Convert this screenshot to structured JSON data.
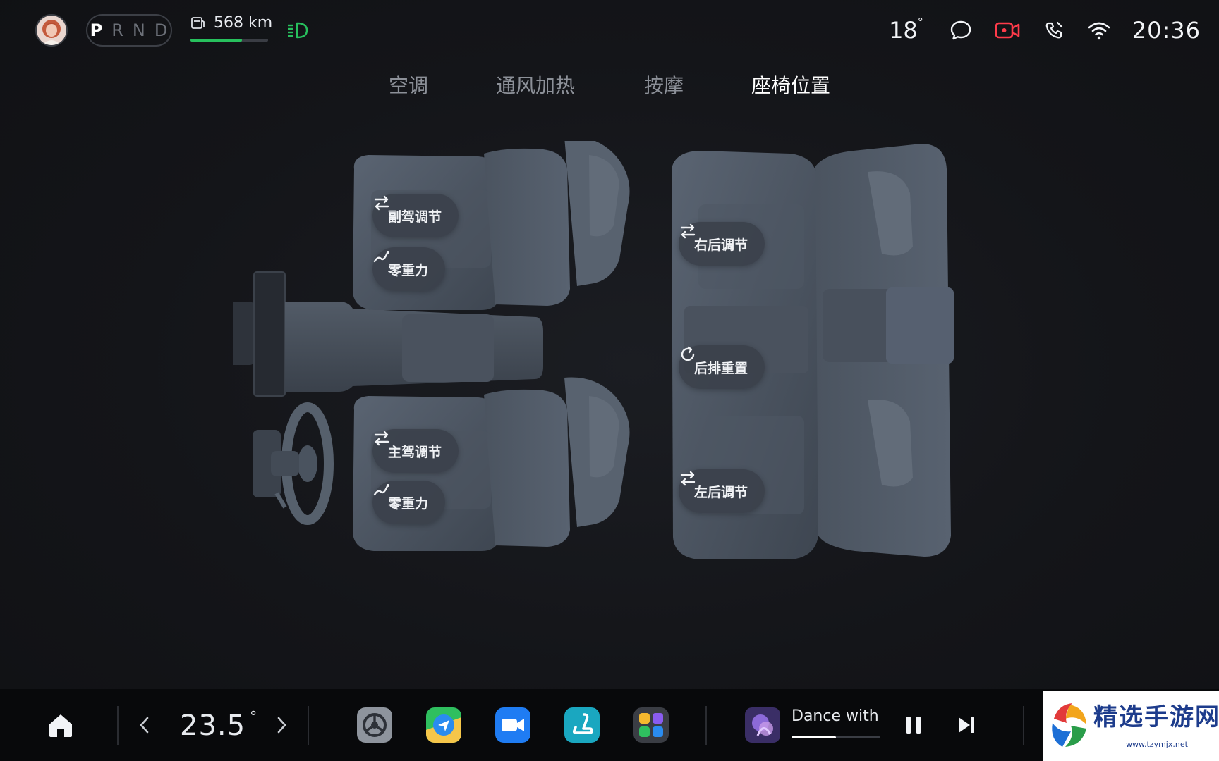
{
  "status": {
    "gears": [
      "P",
      "R",
      "N",
      "D"
    ],
    "active_gear": "P",
    "range": "568 km",
    "range_fraction": 0.66,
    "outside_temp": "18",
    "outside_temp_unit": "°",
    "time": "20:36"
  },
  "tabs": [
    {
      "label": "空调",
      "active": false
    },
    {
      "label": "通风加热",
      "active": false
    },
    {
      "label": "按摩",
      "active": false
    },
    {
      "label": "座椅位置",
      "active": true
    }
  ],
  "seats": {
    "copilot_adjust": "副驾调节",
    "copilot_zero_gravity": "零重力",
    "driver_adjust": "主驾调节",
    "driver_zero_gravity": "零重力",
    "rear_right_adjust": "右后调节",
    "rear_reset": "后排重置",
    "rear_left_adjust": "左后调节"
  },
  "dock": {
    "climate_temp": "23.5",
    "climate_unit": "°",
    "apps": [
      "settings-app",
      "navigation-app",
      "video-app",
      "seat-app",
      "quick-apps"
    ],
    "media_title": "Dance with",
    "media_progress": 0.5
  },
  "watermark": {
    "text": "精选手游网",
    "url": "www.tzymjx.net"
  },
  "colors": {
    "accent_green": "#27c05d",
    "background": "#121317",
    "chip": "#3a404a",
    "seat": "#4c5562"
  }
}
